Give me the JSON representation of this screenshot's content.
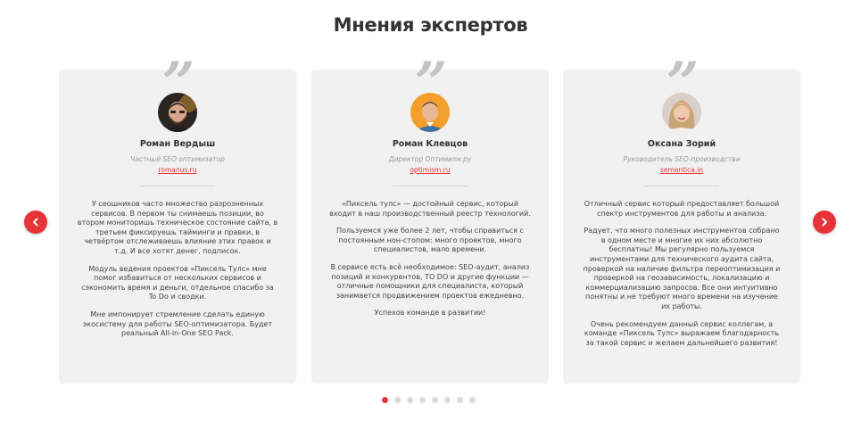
{
  "section": {
    "title": "Мнения экспертов"
  },
  "colors": {
    "accent": "#e63339",
    "card_bg": "#f1f1f1",
    "quote": "#c4c4c4"
  },
  "testimonials": [
    {
      "quote_mark": "”",
      "avatar_icon": "avatar-man-beard-photo",
      "name": "Роман Вердыш",
      "role": "Частный SEO оптимизатор",
      "site": "romanus.ru",
      "paragraphs": [
        "У сеошников часто множество разрозненных сервисов. В первом ты снимаешь позиции, во втором мониторишь техническое состояние сайта, в третьем фиксируешь тайминги и правки, в четвёртом отслеживаешь влияние этих правок и т.д. И все хотят денег, подписок.",
        "Модуль ведения проектов «Пиксель Тулс» мне помог избавиться от нескольких сервисов и сэкономить время и деньги, отдельное спасибо за To Do и сводки.",
        "Мне импонирует стремление сделать единую экосистему для работы SEO-оптимизатора. Будет реальный All-in-One SEO Pack."
      ]
    },
    {
      "quote_mark": "”",
      "avatar_icon": "avatar-man-blue-shirt-photo",
      "name": "Роман Клевцов",
      "role": "Директор Оптимизм.ру",
      "site": "optimism.ru",
      "paragraphs": [
        "«Пиксель тулс» — достойный сервис, который входит в наш производственный реестр технологий.",
        "Пользуемся уже более 2 лет, чтобы справиться с постоянным нон-стопом: много проектов, много специалистов, мало времени.",
        "В сервисе есть всё необходимое: SEO-аудит, анализ позиций и конкурентов, TO DO и другие функции — отличные помощники для специалиста, который занимается продвижением проектов ежедневно.",
        "Успехов команде в развитии!"
      ]
    },
    {
      "quote_mark": "”",
      "avatar_icon": "avatar-woman-blonde-photo",
      "name": "Оксана Зорий",
      "role": "Руководитель SEO-производства",
      "site": "semantica.in",
      "paragraphs": [
        "Отличный сервис который предоставляет большой спектр инструментов для работы и анализа.",
        "Радует, что много полезных инструментов собрано в одном месте и многие их них абсолютно бесплатны! Мы регулярно пользуемся инструментами для технического аудита сайта, проверкой на наличие фильтра переоптимизация и проверкой на геозависимость, локализацию и коммерциализацию запросов. Все они интуитивно понятны и не требуют много времени на изучение их работы.",
        "Очень рекомендуем данный сервис коллегам, а команде «Пиксель Тулс» выражаем благодарность за такой сервис и желаем дальнейшего развития!"
      ]
    }
  ],
  "nav": {
    "prev_icon": "chevron-left-icon",
    "next_icon": "chevron-right-icon"
  },
  "pagination": {
    "total": 8,
    "active": 1
  }
}
